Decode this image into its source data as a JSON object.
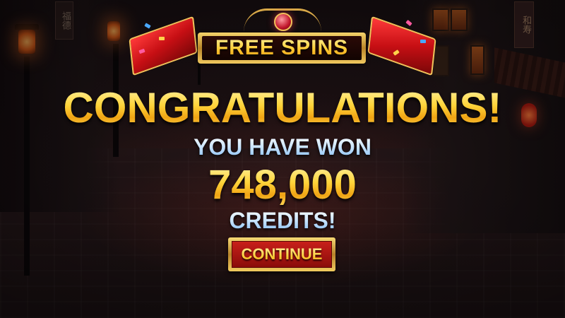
{
  "banner": {
    "title": "FREE SPINS"
  },
  "result": {
    "headline": "CONGRATULATIONS!",
    "subline": "YOU HAVE WON",
    "amount": "748,000",
    "unit": "CREDITS!"
  },
  "actions": {
    "continue_label": "CONTINUE"
  },
  "signs": {
    "left": "福德",
    "right": "和寿"
  },
  "icons": {
    "banner_gem": "gem-icon",
    "lanterns": "lantern-icon"
  },
  "colors": {
    "gold": "#ffd43a",
    "red": "#c8201a",
    "blue_text": "#c8e4ff"
  }
}
